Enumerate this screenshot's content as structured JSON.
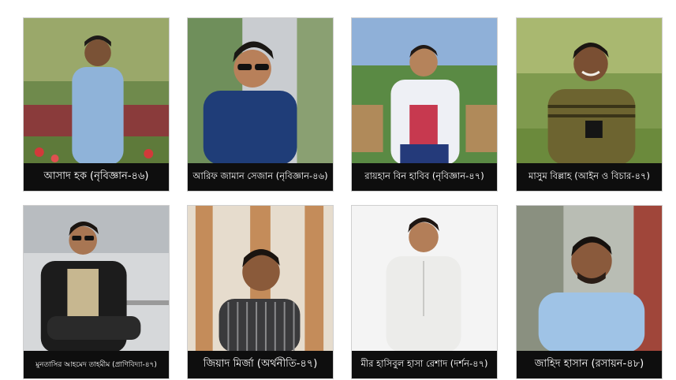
{
  "people": [
    {
      "caption": "আসাদ হক (নৃবিজ্ঞান-৪৬)"
    },
    {
      "caption": "আরিফ জামান সেজান (নৃবিজ্ঞান-৪৬)"
    },
    {
      "caption": "রায়হান বিন হাবিব (নৃবিজ্ঞান-৪৭)"
    },
    {
      "caption": "মাসুম বিল্লাহ (আইন ও বিচার-৪৭)"
    },
    {
      "caption": "মুনতাসির আহমেদ তাহমীম (প্রাণিবিদ্যা-৪৭)"
    },
    {
      "caption": "জিয়াদ মির্জা (অর্থনীতি-৪৭)"
    },
    {
      "caption": "মীর হাসিবুল হাসা রেশাদ (দর্শন-৪৭)"
    },
    {
      "caption": "জাহিদ হাসান (রসায়ন-৪৮)"
    }
  ],
  "colors": {
    "caption_bg": "#0e0e0e",
    "caption_text": "#ffffff",
    "page_bg": "#ffffff"
  }
}
